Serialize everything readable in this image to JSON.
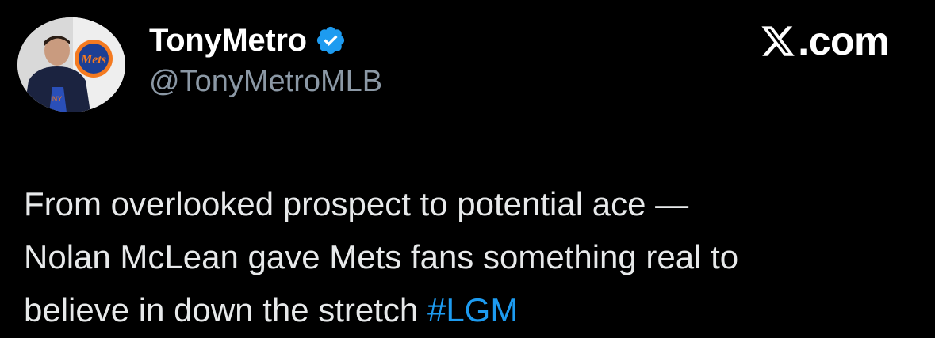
{
  "tweet": {
    "author": {
      "display_name": "TonyMetro",
      "handle": "@TonyMetroMLB",
      "verified": true
    },
    "brand": {
      "label": ".com",
      "logo_icon": "x-logo-icon"
    },
    "text": {
      "line1": "From overlooked prospect to potential ace —",
      "line2": "Nolan McLean gave Mets fans something real to",
      "line3_prefix": "believe in down the stretch ",
      "hashtag": "#LGM"
    }
  },
  "colors": {
    "background": "#000000",
    "name": "#ffffff",
    "handle": "#8b98a5",
    "body_text": "#e7e9ea",
    "link": "#1d9bf0",
    "verified_badge": "#1d9bf0"
  }
}
